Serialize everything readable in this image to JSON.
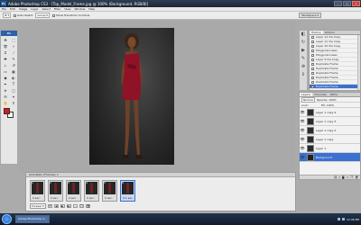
{
  "titlebar": {
    "app_title": "Adobe Photoshop CS3 - [Top_Model_Frame.jpg @ 100% (Background, RGB/8)]"
  },
  "menubar": {
    "items": [
      "File",
      "Edit",
      "Image",
      "Layer",
      "Select",
      "Filter",
      "View",
      "Window",
      "Help"
    ]
  },
  "options": {
    "auto_select": "Auto-Select",
    "show_transform": "Show Transform Controls",
    "workspace": "Workspace ▾"
  },
  "tools": {
    "label": "Ps"
  },
  "history": {
    "tabs": [
      "History",
      "Actions"
    ],
    "items": [
      "Layer 12 Via Copy",
      "Layer 11 Via Copy",
      "Layer 10 Via Copy",
      "Polygonal Lasso",
      "Polygonal Lasso",
      "Layer 9 Via Copy",
      "Duplicate Frame",
      "Duplicate Frame",
      "Duplicate Frame",
      "Duplicate Frame",
      "Duplicate Frame",
      "Duplicate Frame"
    ],
    "selected_index": 11
  },
  "layers": {
    "tabs": [
      "Layers",
      "Channels",
      "Paths"
    ],
    "blend": "Normal",
    "opacity_label": "Opacity: 100%",
    "lock_label": "Lock:",
    "fill_label": "Fill: 100%",
    "rows": [
      "Layer 1 copy 4",
      "Layer 1 copy 3",
      "Layer 1 copy 2",
      "Layer 1 copy",
      "Layer 1",
      "Background"
    ],
    "selected_index": 5
  },
  "animation": {
    "title": "Animation (Frames) ×",
    "frames": [
      {
        "num": "1",
        "delay": "0 sec."
      },
      {
        "num": "2",
        "delay": "0 sec."
      },
      {
        "num": "3",
        "delay": "0 sec."
      },
      {
        "num": "4",
        "delay": "0 sec."
      },
      {
        "num": "5",
        "delay": "0 sec."
      },
      {
        "num": "6",
        "delay": "0.1 sec."
      }
    ],
    "selected_index": 5,
    "loop": "Forever ▾"
  },
  "taskbar": {
    "tasks": [
      "Adobe Photoshop C..."
    ],
    "clock": "12:36 PM"
  },
  "colors": {
    "foreground": "#e1141b",
    "dress": "#8f1226",
    "selection": "#3b6fd0"
  }
}
